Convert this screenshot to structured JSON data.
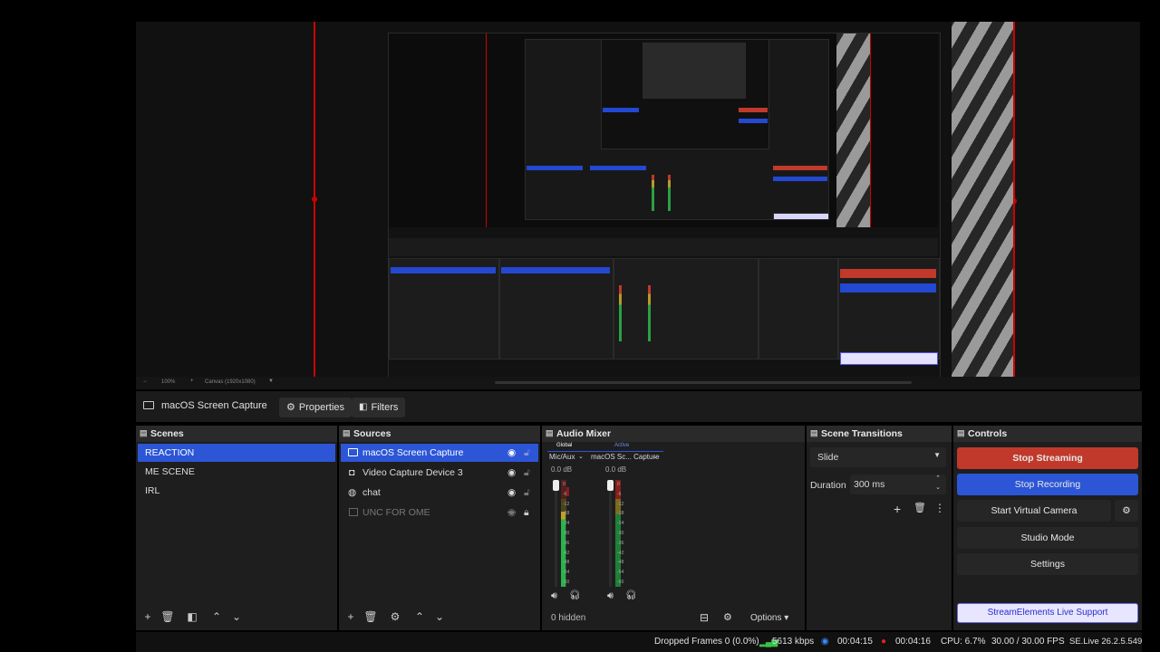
{
  "context_bar": {
    "source_name": "macOS Screen Capture",
    "properties_label": "Properties",
    "filters_label": "Filters"
  },
  "preview_zoom": {
    "zoom": "100%",
    "canvas": "Canvas (1920x1080)"
  },
  "scenes": {
    "title": "Scenes",
    "items": [
      "REACTION",
      "ME SCENE",
      "IRL"
    ],
    "selected": "REACTION"
  },
  "sources": {
    "title": "Sources",
    "items": [
      {
        "label": "macOS Screen Capture",
        "icon": "monitor-icon",
        "visible": true,
        "locked": false
      },
      {
        "label": "Video Capture Device 3",
        "icon": "camera-icon",
        "visible": true,
        "locked": false
      },
      {
        "label": "chat",
        "icon": "browser-icon",
        "visible": true,
        "locked": false
      },
      {
        "label": "UNC FOR OME",
        "icon": "image-icon",
        "visible": false,
        "locked": true
      }
    ]
  },
  "audio_mixer": {
    "title": "Audio Mixer",
    "tab_global": "Global",
    "tab_active": "Active",
    "channels": [
      {
        "name": "Mic/Aux",
        "db": "0.0 dB"
      },
      {
        "name": "macOS Sc... Capture",
        "db": "0.0 dB"
      }
    ],
    "scale": [
      "0",
      "-6",
      "-12",
      "-18",
      "-24",
      "-30",
      "-36",
      "-42",
      "-48",
      "-54",
      "-60"
    ],
    "hidden_count": "0 hidden",
    "options_label": "Options"
  },
  "scene_transitions": {
    "title": "Scene Transitions",
    "transition": "Slide",
    "duration_label": "Duration",
    "duration_value": "300 ms"
  },
  "controls": {
    "title": "Controls",
    "stop_streaming": "Stop Streaming",
    "stop_recording": "Stop Recording",
    "start_virtual_camera": "Start Virtual Camera",
    "studio_mode": "Studio Mode",
    "settings": "Settings",
    "support": "StreamElements Live Support",
    "colors": {
      "streaming": "#c0392b",
      "recording": "#2c56d6",
      "support_bg": "#e8e6ff"
    }
  },
  "status": {
    "dropped_frames": "Dropped Frames 0 (0.0%)",
    "bitrate": "5613 kbps",
    "stream_time": "00:04:15",
    "record_time": "00:04:16",
    "cpu": "CPU: 6.7%",
    "fps": "30.00 / 30.00 FPS",
    "version": "SE.Live 26.2.5.549"
  }
}
